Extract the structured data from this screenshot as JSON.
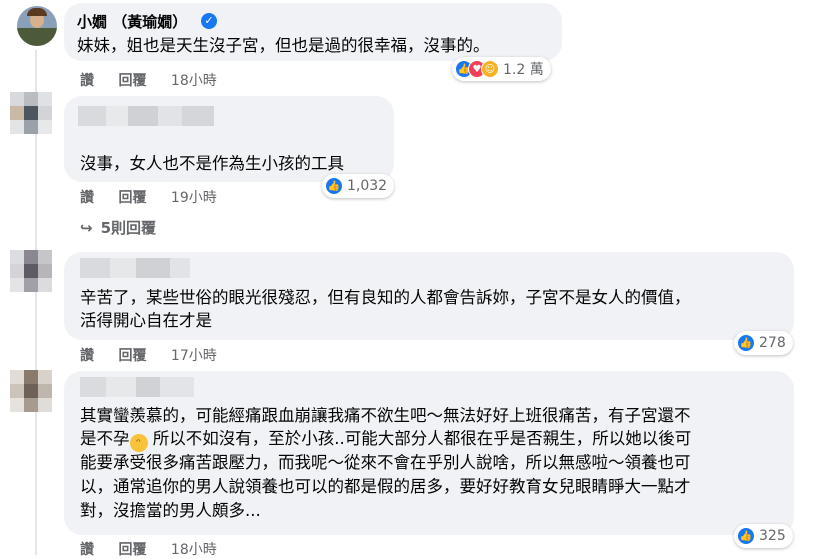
{
  "comments": [
    {
      "author": "小嫺 （黃瑜嫺）",
      "verified": true,
      "text": "妹妹，姐也是天生沒子宮，但也是過的很幸福，沒事的。",
      "actions": {
        "like": "讚",
        "reply": "回覆",
        "time": "18小時"
      },
      "reactions": {
        "icons": [
          "like-icon",
          "love-icon",
          "care-icon"
        ],
        "count": "1.2 萬"
      }
    },
    {
      "author": "",
      "text": "沒事，女人也不是作為生小孩的工具",
      "actions": {
        "like": "讚",
        "reply": "回覆",
        "time": "19小時"
      },
      "reactions": {
        "icons": [
          "like-icon"
        ],
        "count": "1,032"
      },
      "replies": "5則回覆"
    },
    {
      "author": "",
      "text_lines": [
        "辛苦了，某些世俗的眼光很殘忍，但有良知的人都會告訴妳，子宮不是女人的價值，",
        "活得開心自在才是"
      ],
      "actions": {
        "like": "讚",
        "reply": "回覆",
        "time": "17小時"
      },
      "reactions": {
        "icons": [
          "like-icon"
        ],
        "count": "278"
      }
    },
    {
      "author": "",
      "text_lines": [
        "其實蠻羨慕的，可能經痛跟血崩讓我痛不欲生吧～無法好好上班很痛苦，有子宮還不",
        "是不孕",
        " 所以不如沒有，至於小孩..可能大部分人都很在乎是否親生，所以她以後可",
        "能要承受很多痛苦跟壓力，而我呢～從來不會在乎別人說啥，所以無感啦～領養也可",
        "以，通常追你的男人說領養也可以的都是假的居多，要好好教育女兒眼睛睜大一點才",
        "對，沒擔當的男人頗多..."
      ],
      "actions": {
        "like": "讚",
        "reply": "回覆",
        "time": "18小時"
      },
      "reactions": {
        "icons": [
          "like-icon"
        ],
        "count": "325"
      }
    }
  ],
  "colors": {
    "like": "#1877f2",
    "love": "#f33e58",
    "care": "#f7b125",
    "bubble": "#f0f2f5",
    "muted": "#65676b"
  }
}
